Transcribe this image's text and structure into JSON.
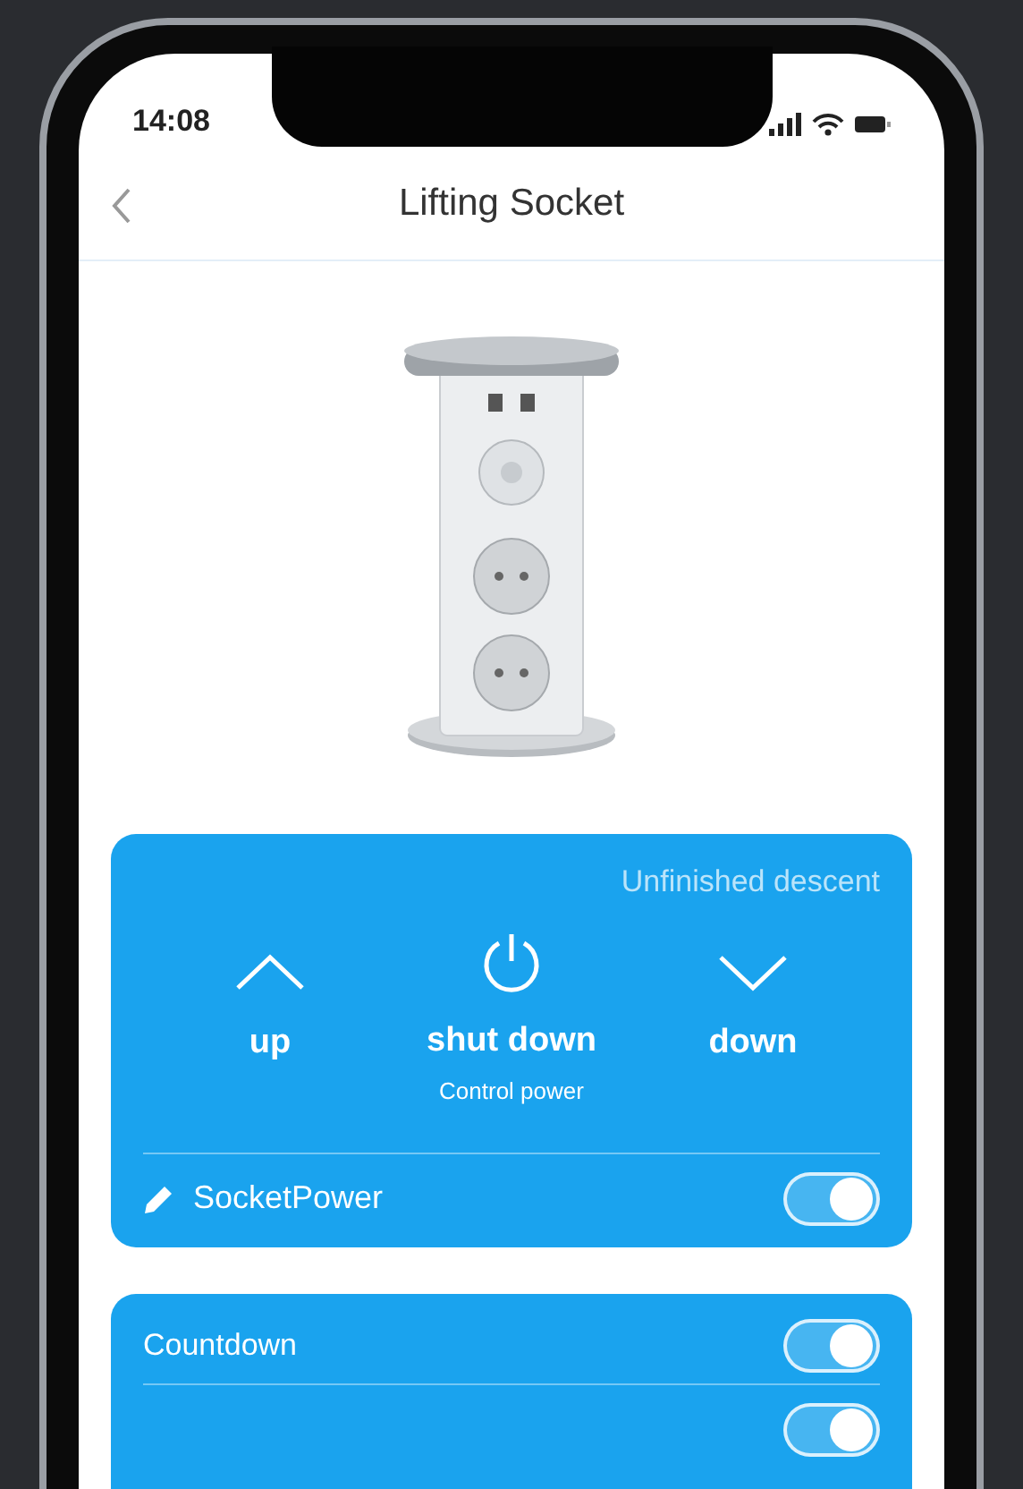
{
  "status_bar": {
    "time": "14:08"
  },
  "header": {
    "title": "Lifting Socket"
  },
  "control_card": {
    "status": "Unfinished descent",
    "controls": [
      {
        "kind": "up",
        "label": "up"
      },
      {
        "kind": "power",
        "label": "shut down",
        "sublabel": "Control power"
      },
      {
        "kind": "down",
        "label": "down"
      }
    ],
    "toggle": {
      "label": "SocketPower",
      "on": true
    }
  },
  "settings": [
    {
      "label": "Countdown",
      "on": true
    },
    {
      "on": true
    }
  ]
}
